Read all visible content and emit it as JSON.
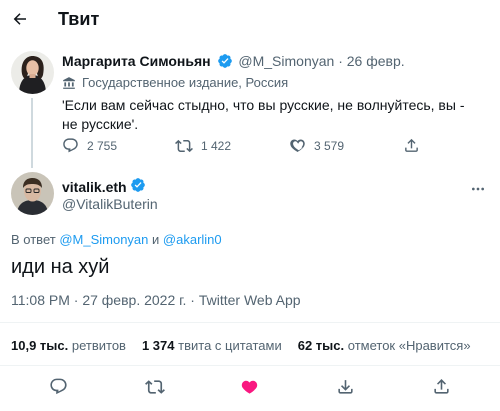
{
  "header": {
    "title": "Твит"
  },
  "quoted_tweet": {
    "author_name": "Маргарита Симоньян",
    "handle": "@M_Simonyan",
    "separator": "·",
    "date": "26 февр.",
    "label": "Государственное издание, Россия",
    "text": "'Если вам сейчас стыдно, что вы русские, не волнуйтесь, вы - не русские'.",
    "replies": "2 755",
    "retweets": "1 422",
    "likes": "3 579"
  },
  "main_tweet": {
    "author_name": "vitalik.eth",
    "handle": "@VitalikButerin",
    "reply_prefix": "В ответ",
    "reply_to_1": "@M_Simonyan",
    "reply_and": "и",
    "reply_to_2": "@akarlin0",
    "text": "иди на хуй",
    "meta": "11:08 PM · 27 февр. 2022 г. · Twitter Web App"
  },
  "stats": {
    "retweets_count": "10,9 тыс.",
    "retweets_label": "ретвитов",
    "quotes_count": "1 374",
    "quotes_label": "твита с цитатами",
    "likes_count": "62 тыс.",
    "likes_label": "отметок «Нравится»"
  },
  "colors": {
    "accent": "#1d9bf0",
    "like": "#f91880",
    "text": "#0f1419",
    "muted": "#536471"
  }
}
